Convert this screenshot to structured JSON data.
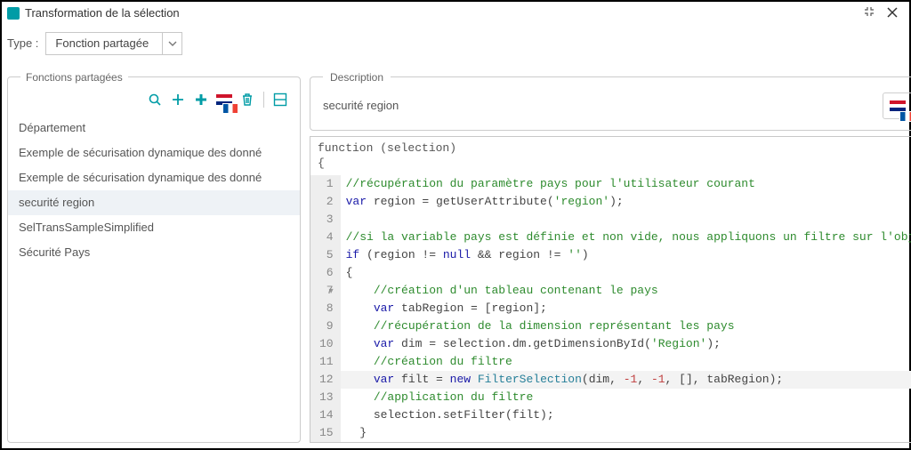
{
  "window": {
    "title": "Transformation de la sélection"
  },
  "type_row": {
    "label": "Type :",
    "selected": "Fonction partagée"
  },
  "shared_fns": {
    "legend": "Fonctions partagées",
    "items": [
      {
        "label": "Département"
      },
      {
        "label": "Exemple de sécurisation dynamique des donné"
      },
      {
        "label": "Exemple de sécurisation dynamique des donné"
      },
      {
        "label": "securité region"
      },
      {
        "label": "SelTransSampleSimplified"
      },
      {
        "label": "Sécurité Pays"
      }
    ],
    "selected_index": 3
  },
  "toolbar_icons": {
    "search": "search-icon",
    "add": "plus-icon",
    "add_group": "plus-heavy-icon",
    "flags": "flags-icon",
    "delete": "trash-icon",
    "layout": "layout-icon"
  },
  "description": {
    "legend": "Description",
    "text": "securité region"
  },
  "code": {
    "signature_line1": "function (selection)",
    "signature_line2": "{",
    "lines": [
      {
        "n": "1",
        "html": "<span class='c-comment'>//récupération du paramètre pays pour l'utilisateur courant</span>"
      },
      {
        "n": "2",
        "html": "<span class='c-key'>var</span> region = getUserAttribute(<span class='c-str'>'region'</span>);"
      },
      {
        "n": "3",
        "html": ""
      },
      {
        "n": "4",
        "html": "<span class='c-comment'>//si la variable pays est définie et non vide, nous appliquons un filtre sur l'obje</span>"
      },
      {
        "n": "5",
        "html": "<span class='c-key'>if</span> (region != <span class='c-key'>null</span> &amp;&amp; region != <span class='c-str'>''</span>)"
      },
      {
        "n": "6",
        "fold": true,
        "html": "{"
      },
      {
        "n": "7",
        "html": "    <span class='c-comment'>//création d'un tableau contenant le pays</span>"
      },
      {
        "n": "8",
        "html": "    <span class='c-key'>var</span> tabRegion = [region];"
      },
      {
        "n": "9",
        "html": "    <span class='c-comment'>//récupération de la dimension représentant les pays</span>"
      },
      {
        "n": "10",
        "html": "    <span class='c-key'>var</span> dim = selection.dm.getDimensionById(<span class='c-str'>'Region'</span>);"
      },
      {
        "n": "11",
        "html": "    <span class='c-comment'>//création du filtre</span>"
      },
      {
        "n": "12",
        "hl": true,
        "html": "    <span class='c-key'>var</span> filt = <span class='c-key'>new</span> <span class='c-class'>FilterSelection</span>(dim, <span class='c-num'>-1</span>, <span class='c-num'>-1</span>, [], tabRegion);"
      },
      {
        "n": "13",
        "html": "    <span class='c-comment'>//application du filtre</span>"
      },
      {
        "n": "14",
        "html": "    selection.setFilter(filt);"
      },
      {
        "n": "15",
        "html": "  }"
      }
    ]
  }
}
